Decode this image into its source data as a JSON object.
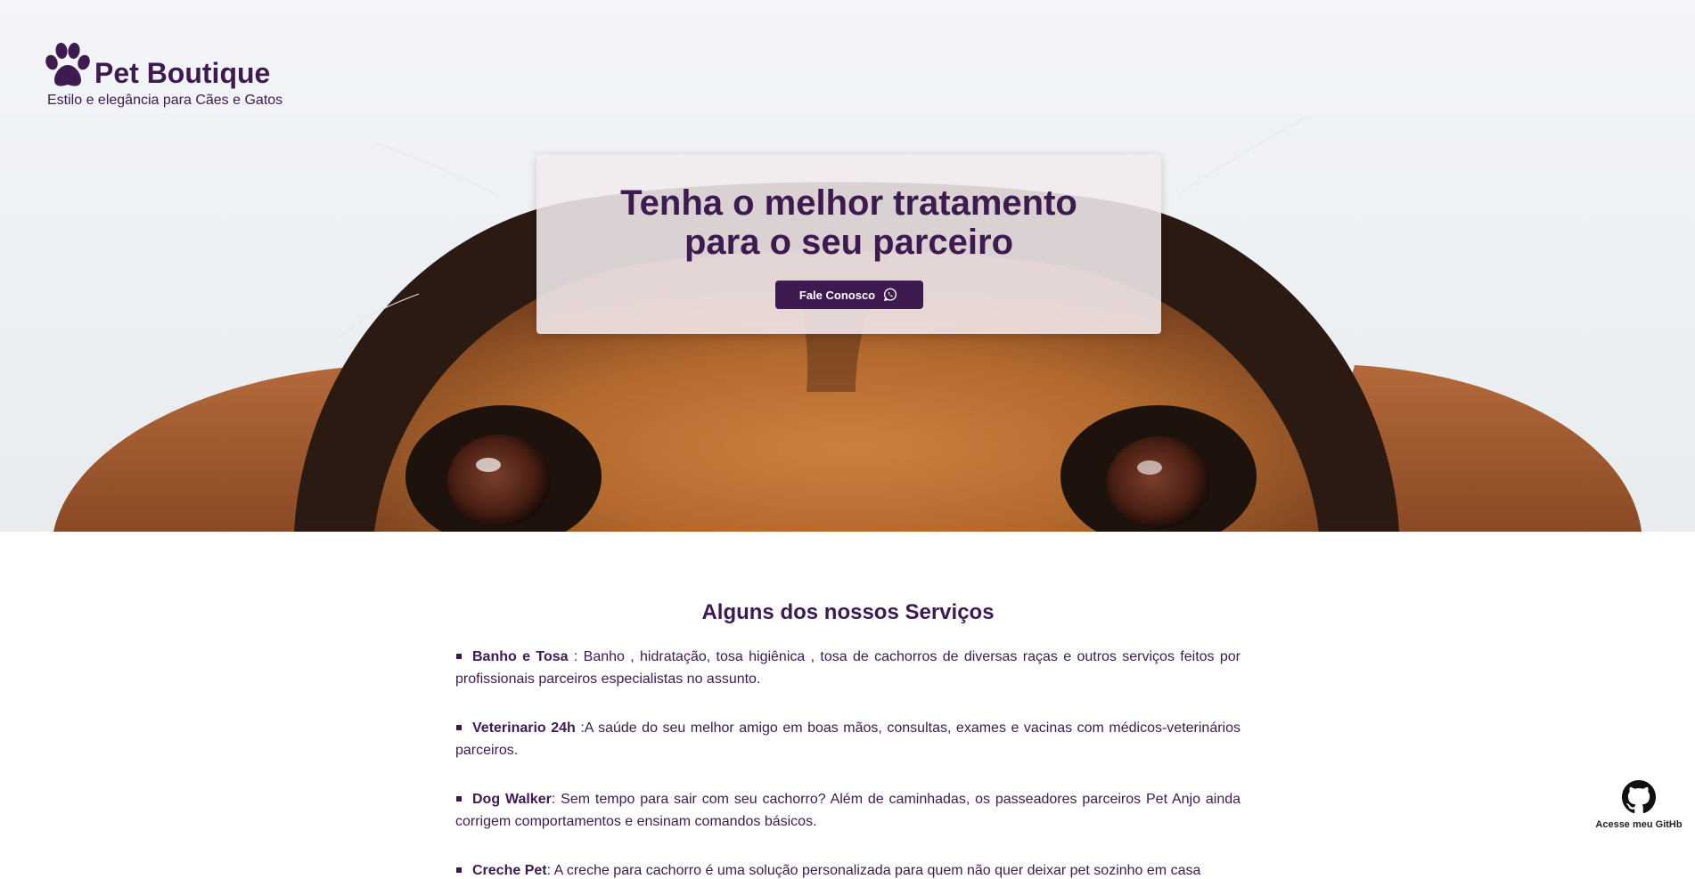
{
  "brand": {
    "name": "Pet Boutique",
    "tagline": "Estilo e elegância para Cães e Gatos",
    "icon": "paw-icon"
  },
  "hero": {
    "title_line1": "Tenha o melhor tratamento",
    "title_line2": "para o seu parceiro",
    "button_label": "Fale Conosco",
    "button_icon": "whatsapp-icon",
    "image": "dog-peeking-photo"
  },
  "services": {
    "heading": "Alguns dos nossos Serviços",
    "items": [
      {
        "name": "Banho e Tosa",
        "text": " : Banho , hidratação, tosa higiênica , tosa de cachorros de diversas raças e outros serviços feitos por profissionais parceiros especialistas no assunto."
      },
      {
        "name": "Veterinario 24h",
        "text": " :A saúde do seu melhor amigo em boas mãos, consultas, exames e vacinas com médicos-veterinários parceiros."
      },
      {
        "name": "Dog Walker",
        "text": ": Sem tempo para sair com seu cachorro? Além de caminhadas, os passeadores parceiros Pet Anjo ainda corrigem comportamentos e ensinam comandos básicos."
      },
      {
        "name": "Creche Pet",
        "text": ": A creche para cachorro é uma solução personalizada para quem não quer deixar pet sozinho em casa"
      }
    ]
  },
  "github": {
    "label": "Acesse meu GitHb",
    "icon": "github-icon"
  },
  "colors": {
    "primary": "#3d1a4f",
    "cta_box": "#f3eaee",
    "background": "#ffffff"
  }
}
